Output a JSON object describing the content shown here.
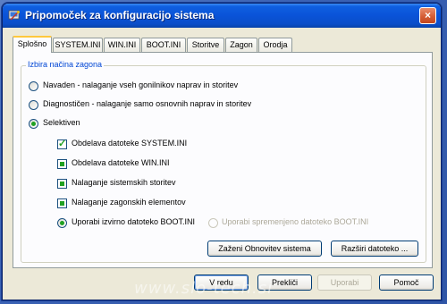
{
  "window": {
    "title": "Pripomoček za konfiguracijo sistema",
    "close_label": "×"
  },
  "tabs": [
    {
      "label": "Splošno"
    },
    {
      "label": "SYSTEM.INI"
    },
    {
      "label": "WIN.INI"
    },
    {
      "label": "BOOT.INI"
    },
    {
      "label": "Storitve"
    },
    {
      "label": "Zagon"
    },
    {
      "label": "Orodja"
    }
  ],
  "startup_group": {
    "legend": "Izbira načina zagona",
    "options": [
      {
        "label": "Navaden - nalaganje vseh gonilnikov naprav in storitev",
        "selected": false
      },
      {
        "label": "Diagnostičen - nalaganje samo osnovnih naprav in storitev",
        "selected": false
      },
      {
        "label": "Selektiven",
        "selected": true
      }
    ],
    "checkboxes": [
      {
        "label": "Obdelava datoteke SYSTEM.INI",
        "state": "checked"
      },
      {
        "label": "Obdelava datoteke WIN.INI",
        "state": "indeterminate"
      },
      {
        "label": "Nalaganje sistemskih storitev",
        "state": "indeterminate"
      },
      {
        "label": "Nalaganje zagonskih elementov",
        "state": "indeterminate"
      }
    ],
    "bootini": [
      {
        "label": "Uporabi izvirno datoteko BOOT.INI",
        "selected": true,
        "enabled": true
      },
      {
        "label": "Uporabi spremenjeno datoteko BOOT.INI",
        "selected": false,
        "enabled": false
      }
    ],
    "restore_button": "Zaženi Obnovitev sistema",
    "expand_button": "Razširi datoteko ..."
  },
  "footer": {
    "ok": "V redu",
    "cancel": "Prekliči",
    "apply": "Uporabi",
    "help": "Pomoč"
  },
  "watermark": "www.slo-tech.si"
}
